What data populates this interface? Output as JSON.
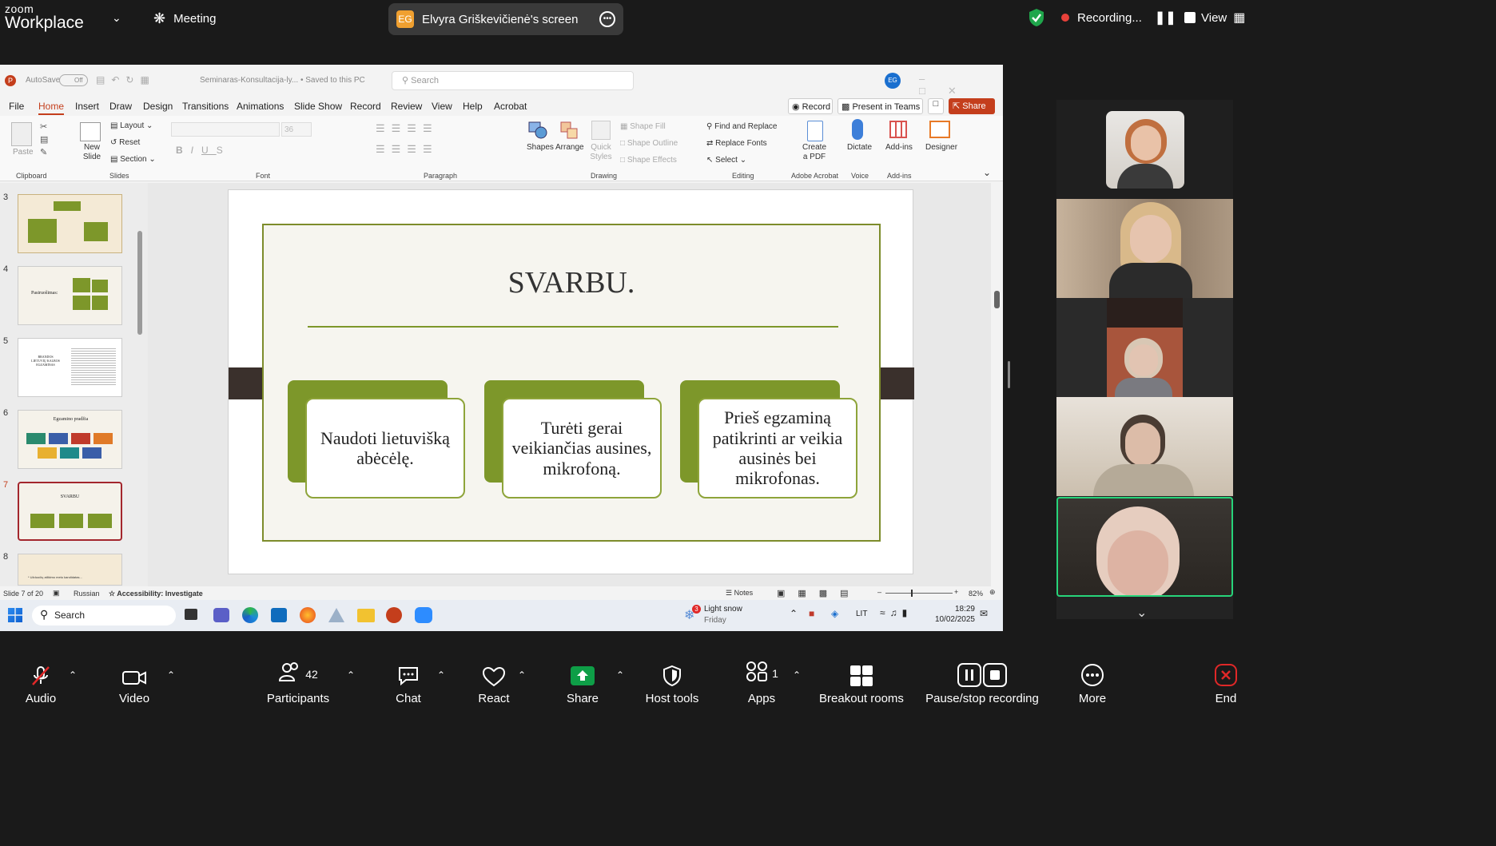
{
  "zoom": {
    "brand_small": "zoom",
    "brand_large": "Workplace",
    "meeting_label": "Meeting",
    "share_initials": "EG",
    "share_title": "Elvyra Griškevičienė's screen",
    "recording_label": "Recording...",
    "view_label": "View"
  },
  "ppt": {
    "autosave": "AutoSave",
    "autosave_state": "Off",
    "file_title": "Seminaras-Konsultacija-ly...",
    "saved_state": "Saved to this PC",
    "search_placeholder": "Search",
    "user_initials": "EG",
    "menu": [
      "File",
      "Home",
      "Insert",
      "Draw",
      "Design",
      "Transitions",
      "Animations",
      "Slide Show",
      "Record",
      "Review",
      "View",
      "Help",
      "Acrobat"
    ],
    "record_btn": "Record",
    "present_btn": "Present in Teams",
    "share_btn": "Share",
    "ribbon": {
      "paste": "Paste",
      "clipboard": "Clipboard",
      "new_slide": "New Slide",
      "layout": "Layout",
      "reset": "Reset",
      "section": "Section",
      "slides": "Slides",
      "font_size": "36",
      "font": "Font",
      "paragraph": "Paragraph",
      "shapes": "Shapes",
      "arrange": "Arrange",
      "quick_styles": "Quick Styles",
      "shape_fill": "Shape Fill",
      "shape_outline": "Shape Outline",
      "shape_effects": "Shape Effects",
      "drawing": "Drawing",
      "find_replace": "Find and Replace",
      "replace_fonts": "Replace Fonts",
      "select": "Select",
      "editing": "Editing",
      "create_pdf": "Create a PDF",
      "adobe_acrobat": "Adobe Acrobat",
      "dictate": "Dictate",
      "voice": "Voice",
      "addins": "Add-ins",
      "addins_group": "Add-ins",
      "designer": "Designer"
    },
    "thumb_numbers": [
      "3",
      "4",
      "5",
      "6",
      "7",
      "8"
    ],
    "thumb_texts": {
      "t4": "Pasiruošimas:",
      "t5": "BRANDOS LIETUVIŲ KALBOS EGZAMINAS",
      "t6": "Egzamino pradžia",
      "t7": "SVARBU",
      "t8": "* Užduočių atlikimo metu kandidatas..."
    },
    "slide": {
      "title": "SVARBU.",
      "cards": [
        "Naudoti lietuvišką abėcėlę.",
        "Turėti gerai veikiančias ausines, mikrofoną.",
        "Prieš egzaminą patikrinti ar veikia ausinės bei mikrofonas."
      ]
    },
    "status": {
      "slide_count": "Slide 7 of 20",
      "language": "Russian",
      "accessibility": "Accessibility: Investigate",
      "notes": "Notes",
      "zoom_level": "82%"
    }
  },
  "taskbar": {
    "search": "Search",
    "weather_badge": "3",
    "weather": "Light snow",
    "weather_day": "Friday",
    "lang": "LIT",
    "time": "18:29",
    "date": "10/02/2025"
  },
  "bottom": {
    "audio": "Audio",
    "video": "Video",
    "participants": "Participants",
    "participants_count": "42",
    "chat": "Chat",
    "react": "React",
    "share": "Share",
    "host_tools": "Host tools",
    "apps": "Apps",
    "apps_count": "1",
    "breakout": "Breakout rooms",
    "pause_stop": "Pause/stop recording",
    "more": "More",
    "end": "End"
  },
  "colors": {
    "accent_green": "#7d972a",
    "share_green": "#0e9e47",
    "end_red": "#e02828",
    "ppt_red": "#c43e1c"
  }
}
